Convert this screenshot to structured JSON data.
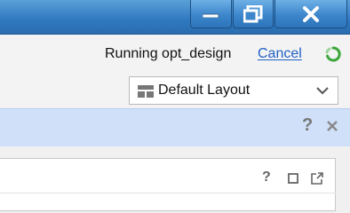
{
  "window": {
    "buttons": [
      "minimize",
      "maximize",
      "close"
    ]
  },
  "toolbar": {
    "status_text": "Running opt_design",
    "cancel_label": "Cancel",
    "layout_selected": "Default Layout"
  },
  "banner": {
    "help_label": "?"
  },
  "panel": {
    "help_label": "?"
  },
  "colors": {
    "titlebar": "#2f78bf",
    "link": "#2160c4",
    "spinner": "#3ca63c",
    "banner": "#cfe0f8"
  },
  "icons": [
    "minimize-icon",
    "maximize-icon",
    "close-icon",
    "progress-spinner-icon",
    "layout-grid-icon",
    "chevron-down-icon",
    "help-icon",
    "close-banner-icon",
    "maximize-panel-icon",
    "float-panel-icon"
  ]
}
